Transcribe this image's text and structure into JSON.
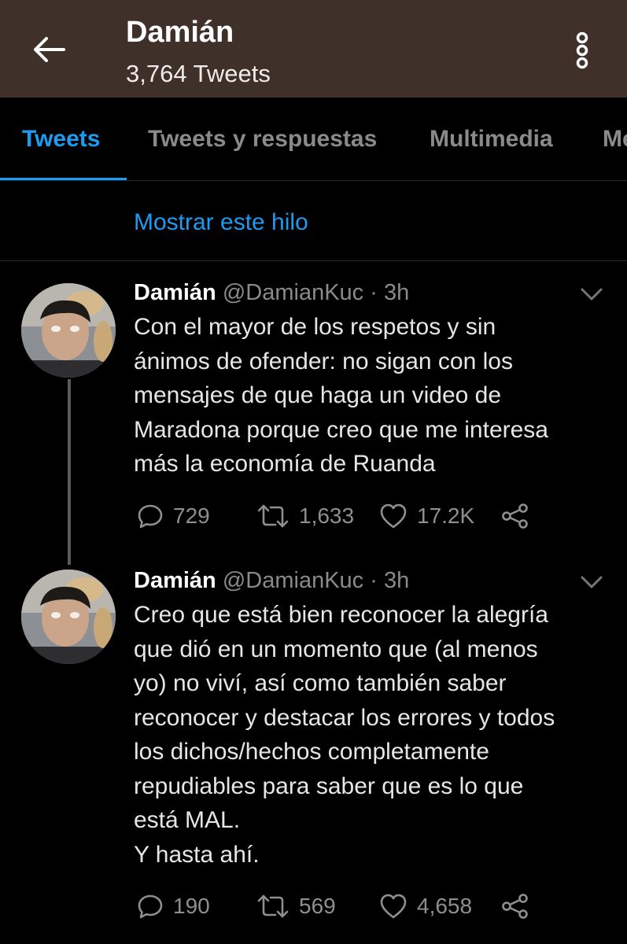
{
  "header": {
    "title": "Damián",
    "subtitle": "3,764 Tweets"
  },
  "tabs": [
    {
      "label": "Tweets",
      "active": true
    },
    {
      "label": "Tweets y respuestas",
      "active": false
    },
    {
      "label": "Multimedia",
      "active": false
    },
    {
      "label": "Me",
      "active": false
    }
  ],
  "thread_link": "Mostrar este hilo",
  "tweets": [
    {
      "name": "Damián",
      "handle": "@DamianKuc",
      "sep": "·",
      "time": "3h",
      "lines": [
        "Con el mayor de los respetos y sin",
        "ánimos de ofender: no sigan con los",
        "mensajes de que haga un video de",
        "Maradona porque creo que me interesa",
        "más la economía de Ruanda"
      ],
      "replies": "729",
      "retweets": "1,633",
      "likes": "17.2K"
    },
    {
      "name": "Damián",
      "handle": "@DamianKuc",
      "sep": "·",
      "time": "3h",
      "lines": [
        "Creo que está bien reconocer la alegría",
        "que dió en un momento que (al menos",
        "yo) no viví, así como también saber",
        "reconocer y destacar los errores y todos",
        "los dichos/hechos completamente",
        "repudiables para saber que es lo que",
        "está MAL.",
        "Y hasta ahí."
      ],
      "replies": "190",
      "retweets": "569",
      "likes": "4,658"
    }
  ],
  "icons": {
    "back": "arrow-left-icon",
    "more": "more-vertical-icon",
    "caret": "chevron-down-icon",
    "reply": "reply-icon",
    "retweet": "retweet-icon",
    "like": "heart-icon",
    "share": "share-icon"
  },
  "colors": {
    "header_bg": "#3f302a",
    "accent": "#1d9bf0",
    "background": "#000000",
    "muted": "#8a8a8a"
  }
}
